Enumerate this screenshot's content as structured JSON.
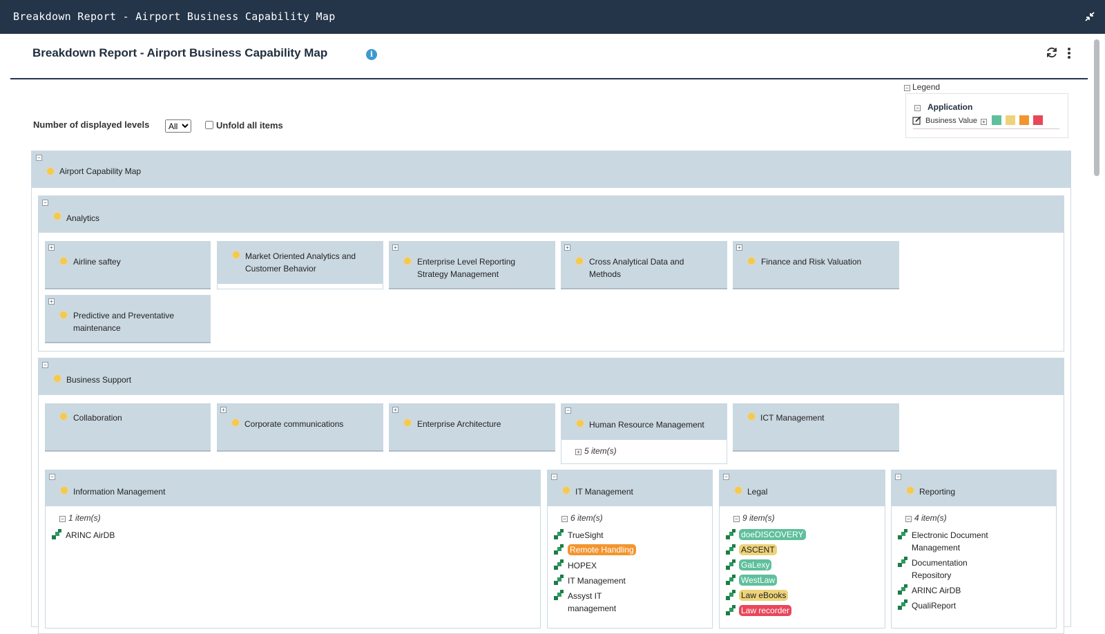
{
  "window": {
    "title": "Breakdown Report - Airport Business Capability Map"
  },
  "header": {
    "title": "Breakdown Report - Airport Business Capability Map"
  },
  "legend": {
    "label": "Legend",
    "section": "Application",
    "row_label": "Business Value",
    "colors": [
      "#5fbf9c",
      "#eed37a",
      "#f2952f",
      "#e8475b"
    ]
  },
  "controls": {
    "levels_label": "Number of displayed levels",
    "levels_value": "All",
    "unfold_label": "Unfold all items"
  },
  "root": {
    "label": "Airport Capability Map"
  },
  "analytics": {
    "label": "Analytics",
    "cards": [
      {
        "label": "Airline saftey"
      },
      {
        "label": "Market Oriented Analytics and Customer Behavior"
      },
      {
        "label": "Enterprise Level Reporting Strategy Management"
      },
      {
        "label": "Cross Analytical Data and Methods"
      },
      {
        "label": "Finance and Risk Valuation"
      },
      {
        "label": "Predictive and Preventative maintenance"
      }
    ]
  },
  "business_support": {
    "label": "Business Support",
    "cards": [
      {
        "label": "Collaboration"
      },
      {
        "label": "Corporate communications"
      },
      {
        "label": "Enterprise Architecture"
      },
      {
        "label": "Human Resource Management",
        "count": "5 item(s)"
      },
      {
        "label": "ICT Management"
      }
    ],
    "info_mgmt": {
      "label": "Information Management",
      "count": "1 item(s)",
      "items": [
        "ARINC AirDB"
      ]
    },
    "it_mgmt": {
      "label": "IT Management",
      "count": "6 item(s)",
      "items": [
        "TrueSight",
        "Remote Handling",
        "HOPEX",
        "IT Management",
        "Assyst IT management"
      ]
    },
    "legal": {
      "label": "Legal",
      "count": "9 item(s)",
      "items": [
        "doeDISCOVERY",
        "ASCENT",
        "GaLexy",
        "WestLaw",
        "Law eBooks",
        "Law recorder"
      ]
    },
    "reporting": {
      "label": "Reporting",
      "count": "4 item(s)",
      "items": [
        "Electronic Document Management",
        "Documentation Repository",
        "ARINC AirDB",
        "QualiReport"
      ]
    }
  }
}
